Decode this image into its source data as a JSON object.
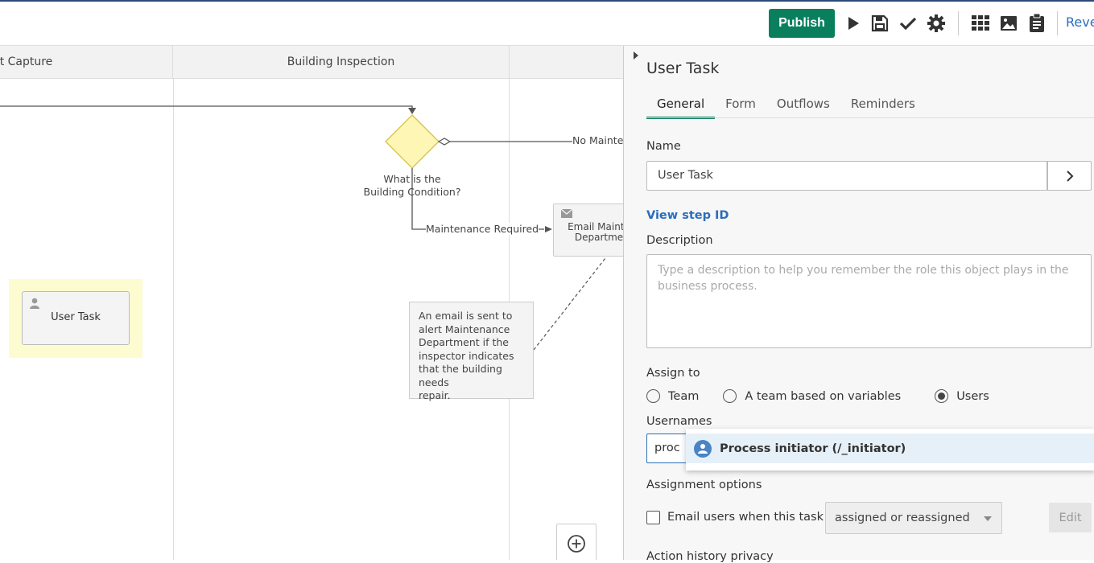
{
  "toolbar": {
    "publish_label": "Publish",
    "revert_label": "Reve",
    "icons": [
      "run-icon",
      "save-icon",
      "validate-icon",
      "settings-icon",
      "grid-icon",
      "image-icon",
      "clipboard-icon"
    ]
  },
  "canvas": {
    "lanes": [
      {
        "title": "t Capture"
      },
      {
        "title": "Building Inspection"
      },
      {
        "title": ""
      }
    ],
    "gateway_label": "What is the\nBuilding Condition?",
    "flow_labels": {
      "no_maintenance": "No Mainte",
      "maintenance_required": "Maintenance Required"
    },
    "user_task_label": "User Task",
    "email_task_label": "Email Mainte\nDepartme",
    "annotation_text": "An email is sent to\nalert Maintenance\nDepartment if the\ninspector indicates\nthat the building needs\nrepair."
  },
  "panel": {
    "title": "User Task",
    "tabs": [
      {
        "label": "General",
        "active": true
      },
      {
        "label": "Form",
        "active": false
      },
      {
        "label": "Outflows",
        "active": false
      },
      {
        "label": "Reminders",
        "active": false
      }
    ],
    "name_label": "Name",
    "name_value": "User Task",
    "view_step_id": "View step ID",
    "description_label": "Description",
    "description_placeholder": "Type a description to help you remember the role this object plays in the business process.",
    "assign_to_label": "Assign to",
    "assign_options": [
      {
        "label": "Team",
        "selected": false
      },
      {
        "label": "A team based on variables",
        "selected": false
      },
      {
        "label": "Users",
        "selected": true
      }
    ],
    "usernames_label": "Usernames",
    "usernames_value": "proc",
    "suggestion": "Process initiator (/_initiator)",
    "assignment_options_label": "Assignment options",
    "email_checkbox_label": "Email users when this task is",
    "email_checkbox_checked": false,
    "email_select_value": "assigned or reassigned",
    "edit_label": "Edit",
    "next_section_label": "Action history privacy"
  },
  "colors": {
    "accent": "#0a7f5e",
    "link": "#2a6ebb",
    "gateway": "#fdf6b4"
  }
}
